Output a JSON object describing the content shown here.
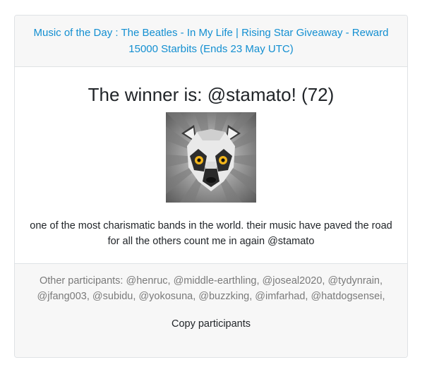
{
  "header": {
    "title_link": "Music of the Day : The Beatles - In My Life | Rising Star Giveaway - Reward 15000 Starbits (Ends 23 May UTC)"
  },
  "winner": {
    "heading": "The winner is: @stamato! (72)",
    "avatar_icon": "lemur-avatar-icon",
    "comment": "one of the most charismatic bands in the world. their music have paved the road for all the others count me in again @stamato"
  },
  "footer": {
    "participants_text": "Other participants: @henruc, @middle-earthling, @joseal2020, @tydynrain, @jfang003, @subidu, @yokosuna, @buzzking, @imfarhad, @hatdogsensei,",
    "copy_button_label": "Copy participants"
  },
  "colors": {
    "link": "#138fd1",
    "header_bg": "#f7f7f7",
    "border": "#dfe2e5",
    "muted_text": "#7a7a7a"
  }
}
